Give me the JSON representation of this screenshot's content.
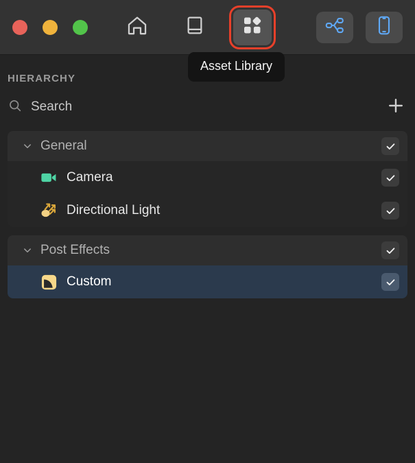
{
  "window": {
    "traffic_lights": [
      {
        "name": "close-button",
        "color": "#e8635a"
      },
      {
        "name": "minimize-button",
        "color": "#f0b33c"
      },
      {
        "name": "maximize-button",
        "color": "#52c44a"
      }
    ]
  },
  "toolbar": {
    "items": [
      {
        "id": "home",
        "icon": "home-icon",
        "label": "Home",
        "active": false,
        "chip": false,
        "highlighted": false
      },
      {
        "id": "library",
        "icon": "book-icon",
        "label": "Documentation",
        "active": false,
        "chip": false,
        "highlighted": false
      },
      {
        "id": "assets",
        "icon": "asset-library-icon",
        "label": "Asset Library",
        "active": true,
        "chip": false,
        "highlighted": true
      }
    ],
    "right_items": [
      {
        "id": "graph",
        "icon": "node-graph-icon",
        "label": "Node Graph"
      },
      {
        "id": "device",
        "icon": "device-preview-icon",
        "label": "Device Preview"
      }
    ],
    "highlight_color": "#e8402a",
    "accent_blue": "#5fa8f5"
  },
  "tooltip": {
    "text": "Asset Library",
    "visible": true
  },
  "panel": {
    "title": "HIERARCHY",
    "search": {
      "icon": "search-icon",
      "placeholder": "Search",
      "value": ""
    },
    "add_button": {
      "icon": "plus-icon",
      "label": "Add"
    }
  },
  "hierarchy": {
    "groups": [
      {
        "label": "General",
        "expanded": true,
        "checked": true,
        "chevron": "chevron-down-icon",
        "items": [
          {
            "label": "Camera",
            "icon": "camera-icon",
            "icon_color": "#4ed3a4",
            "checked": true,
            "selected": false
          },
          {
            "label": "Directional Light",
            "icon": "directional-light-icon",
            "icon_color": "#f2d184",
            "checked": true,
            "selected": false
          }
        ]
      },
      {
        "label": "Post Effects",
        "expanded": true,
        "checked": true,
        "chevron": "chevron-down-icon",
        "items": [
          {
            "label": "Custom",
            "icon": "post-effect-icon",
            "icon_color": "#f7d88a",
            "checked": true,
            "selected": true
          }
        ]
      }
    ]
  }
}
